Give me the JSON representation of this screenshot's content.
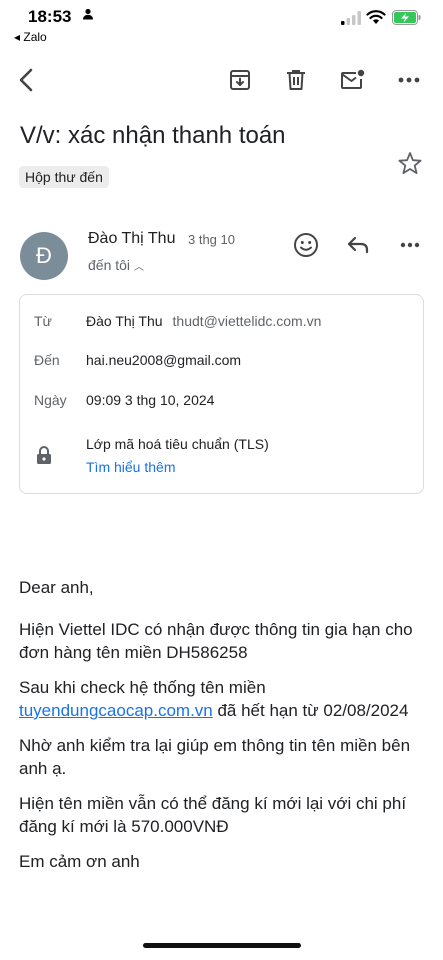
{
  "status": {
    "time": "18:53",
    "back_app": "◂ Zalo"
  },
  "toolbar": {
    "back_icon": "arrow-back-icon",
    "archive_icon": "archive-icon",
    "delete_icon": "trash-icon",
    "unread_icon": "mark-unread-icon",
    "more_icon": "more-vertical-icon"
  },
  "email": {
    "subject": "V/v: xác nhận thanh toán",
    "label": "Hộp thư đến",
    "sender": {
      "initial": "Đ",
      "name": "Đào Thị Thu",
      "date": "3 thg 10",
      "to_line": "đến tôi"
    },
    "details": {
      "from_label": "Từ",
      "from_name": "Đào Thị Thu",
      "from_email": "thudt@viettelidc.com.vn",
      "to_label": "Đến",
      "to_value": "hai.neu2008@gmail.com",
      "date_label": "Ngày",
      "date_value": "09:09 3 thg 10, 2024",
      "security_text": "Lớp mã hoá tiêu chuẩn (TLS)",
      "learn_more": "Tìm hiểu thêm"
    },
    "body": {
      "greeting": "Dear anh,",
      "p1": "Hiện Viettel IDC có nhận được thông tin gia hạn cho đơn hàng tên miền DH586258",
      "p2_before": "Sau khi check hệ thống tên miền ",
      "p2_link": "tuyendungcaocap.com.vn",
      "p2_after": " đã hết hạn từ 02/08/2024",
      "p3": "Nhờ anh kiểm tra lại giúp em thông tin tên miền bên anh ạ.",
      "p4": "Hiện tên miền vẫn có thể đăng kí mới lại với chi phí đăng kí mới là 570.000VNĐ",
      "p5": "Em cảm ơn anh"
    }
  },
  "colors": {
    "accent": "#1a73e8",
    "avatar": "#7a8d98",
    "battery": "#34c759"
  }
}
